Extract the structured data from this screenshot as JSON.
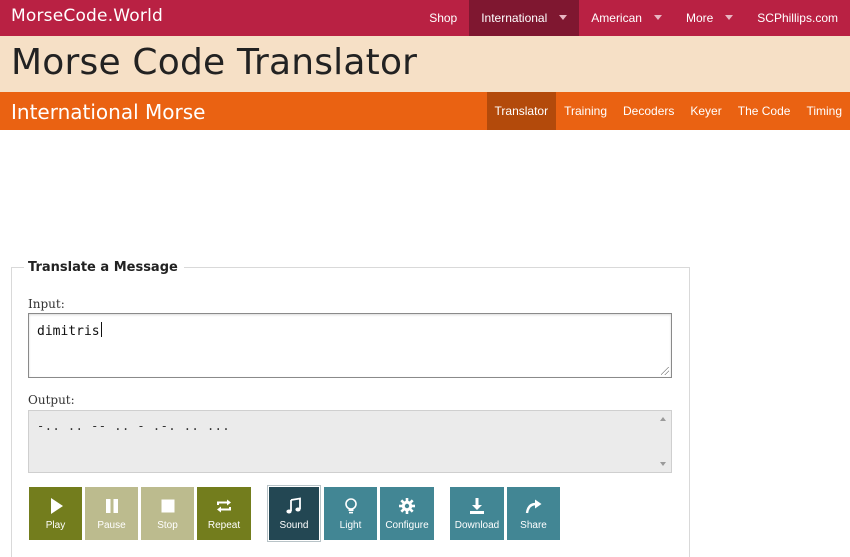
{
  "header": {
    "brand": "MorseCode.World",
    "nav": [
      {
        "label": "Shop",
        "dropdown": false,
        "active": false
      },
      {
        "label": "International",
        "dropdown": true,
        "active": true
      },
      {
        "label": "American",
        "dropdown": true,
        "active": false
      },
      {
        "label": "More",
        "dropdown": true,
        "active": false
      },
      {
        "label": "SCPhillips.com",
        "dropdown": false,
        "active": false
      }
    ]
  },
  "page": {
    "title": "Morse Code Translator",
    "section": "International Morse",
    "subnav": [
      {
        "label": "Translator",
        "active": true
      },
      {
        "label": "Training",
        "active": false
      },
      {
        "label": "Decoders",
        "active": false
      },
      {
        "label": "Keyer",
        "active": false
      },
      {
        "label": "The Code",
        "active": false
      },
      {
        "label": "Timing",
        "active": false
      }
    ]
  },
  "translator": {
    "legend": "Translate a Message",
    "input_label": "Input:",
    "input_value": "dimitris",
    "output_label": "Output:",
    "output_value": "-.. .. -- .. - .-. .. ..."
  },
  "controls": {
    "play": {
      "label": "Play",
      "icon": "play-icon"
    },
    "pause": {
      "label": "Pause",
      "icon": "pause-icon"
    },
    "stop": {
      "label": "Stop",
      "icon": "stop-icon"
    },
    "repeat": {
      "label": "Repeat",
      "icon": "repeat-icon"
    },
    "sound": {
      "label": "Sound",
      "icon": "music-note-icon"
    },
    "light": {
      "label": "Light",
      "icon": "lightbulb-icon"
    },
    "configure": {
      "label": "Configure",
      "icon": "gear-icon"
    },
    "download": {
      "label": "Download",
      "icon": "download-icon"
    },
    "share": {
      "label": "Share",
      "icon": "share-icon"
    }
  },
  "colors": {
    "top_bar": "#b92143",
    "top_bar_active": "#7f1730",
    "title_band": "#f6e0c6",
    "sub_bar": "#ea6212",
    "sub_bar_active": "#b34a0b",
    "olive_button": "#737d1d",
    "olive_button_disabled": "#bcbb8e",
    "teal_button": "#428694",
    "teal_button_selected": "#234753"
  }
}
